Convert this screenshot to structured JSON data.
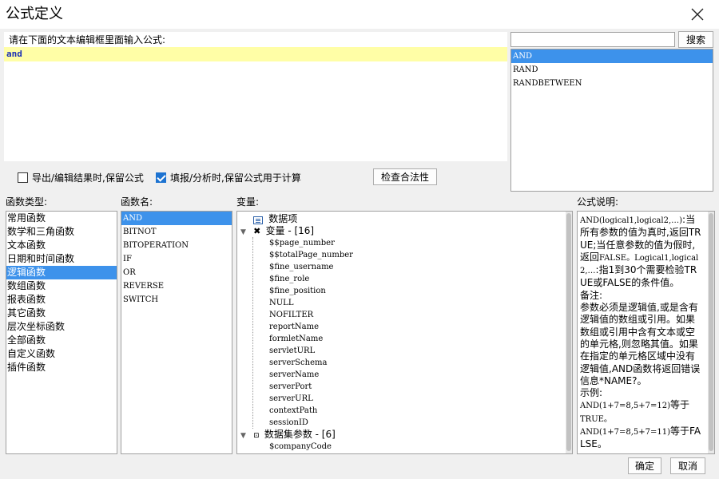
{
  "window": {
    "title": "公式定义"
  },
  "editor": {
    "label": "请在下面的文本编辑框里面输入公式:",
    "content": "and"
  },
  "search": {
    "value": "",
    "button": "搜索"
  },
  "results": [
    "AND",
    "RAND",
    "RANDBETWEEN"
  ],
  "options": {
    "keep_formula_export": {
      "label": "导出/编辑结果时,保留公式",
      "checked": false
    },
    "keep_formula_fill": {
      "label": "填报/分析时,保留公式用于计算",
      "checked": true
    },
    "check_button": "检查合法性"
  },
  "labels": {
    "categories": "函数类型:",
    "functions": "函数名:",
    "variables": "变量:",
    "description": "公式说明:"
  },
  "categories": [
    "常用函数",
    "数学和三角函数",
    "文本函数",
    "日期和时间函数",
    "逻辑函数",
    "数组函数",
    "报表函数",
    "其它函数",
    "层次坐标函数",
    "全部函数",
    "自定义函数",
    "插件函数"
  ],
  "functions": [
    "AND",
    "BITNOT",
    "BITOPERATION",
    "IF",
    "OR",
    "REVERSE",
    "SWITCH"
  ],
  "variables": {
    "data_item": "数据项",
    "var_group": "变量 - [16]",
    "var_items": [
      "$$page_number",
      "$$totalPage_number",
      "$fine_username",
      "$fine_role",
      "$fine_position",
      "NULL",
      "NOFILTER",
      "reportName",
      "formletName",
      "servletURL",
      "serverSchema",
      "serverName",
      "serverPort",
      "serverURL",
      "contextPath",
      "sessionID"
    ],
    "dataset_group": "数据集参数 - [6]",
    "dataset_items": [
      "$companyCode"
    ]
  },
  "description": {
    "syntax": "AND(logical1,logical2,…)",
    "p1": ":当所有参数的值为真时,返回TRUE;当任意参数的值为假时,返回",
    "p1b": "FALSE。Logical1,logical2,…",
    "p2": ":指1到30个需要检验TRUE或FALSE的条件值。",
    "note": "备注:",
    "p3": "参数必须是逻辑值,或是含有逻辑值的数组或引用。如果数组或引用中含有文本或空的单元格,则忽略其值。如果在指定的单元格区域中没有逻辑值,AND函数将返回错误信息*NAME?。",
    "example": "示例:",
    "ex1a": "AND(1+7=8,5+7=12)",
    "ex1b": "等于",
    "ex1c": "TRUE。",
    "ex2a": "AND(1+7=8,5+7=11)",
    "ex2b": "等于FALSE。"
  },
  "buttons": {
    "ok": "确定",
    "cancel": "取消"
  }
}
